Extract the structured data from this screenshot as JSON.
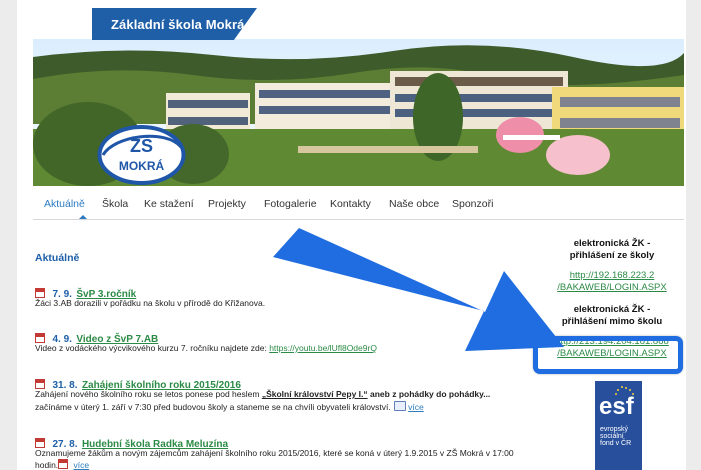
{
  "site": {
    "title": "Základní škola Mokrá",
    "logo_text": "ZŠ MOKRÁ"
  },
  "nav": {
    "items": [
      {
        "label": "Aktuálně",
        "active": true
      },
      {
        "label": "Škola"
      },
      {
        "label": "Ke stažení"
      },
      {
        "label": "Projekty"
      },
      {
        "label": "Fotogalerie"
      },
      {
        "label": "Kontakty"
      },
      {
        "label": "Naše obce"
      },
      {
        "label": "Sponzoři"
      }
    ]
  },
  "main": {
    "section_title": "Aktuálně",
    "news": [
      {
        "date": "7. 9.",
        "title": "ŠvP 3.ročník",
        "text": "Žáci 3.AB dorazili v pořádku na školu v přírodě do Křižanova."
      },
      {
        "date": "4. 9.",
        "title": "Video z ŠvP 7.AB",
        "text": "Video z vodáckého výcvikového kurzu 7. ročníku najdete zde: ",
        "link": "https://youtu.be/lUfl8Ode9rQ"
      },
      {
        "date": "31. 8.",
        "title": "Zahájení školního roku 2015/2016",
        "text_pre": "Zahájení nového školního roku se letos ponese pod heslem ",
        "text_highlight": "„Školní království Pepy I.“",
        "text_post": " aneb z pohádky do pohádky...",
        "text_line2": "začínáme v úterý 1. září v 7:30 před budovou školy a staneme se na chvíli obyvateli království.",
        "more": "více"
      },
      {
        "date": "27. 8.",
        "title": "Hudební škola Radka Meluzína",
        "text": "Oznamujeme žákům a novým zájemcům zahájení školního roku 2015/2016, které se koná v úterý 1.9.2015 v ZŠ Mokrá v 17:00",
        "text_line2": "hodin.",
        "more": "více"
      }
    ]
  },
  "sidebar": {
    "block1": {
      "title_line1": "elektronická ŽK -",
      "title_line2": "přihlášení ze školy",
      "link_line1": "http://192.168.223.2",
      "link_line2": "/BAKAWEB/LOGIN.ASPX"
    },
    "block2": {
      "title_line1": "elektronická ŽK -",
      "title_line2": "přihlášení mimo školu",
      "link_line1": "http://213.194.204.181:888",
      "link_line2": "/BAKAWEB/LOGIN.ASPX"
    },
    "esf": {
      "brand": "esf",
      "caption": "evropský\nsociální\nfond v ČR"
    }
  },
  "colors": {
    "accent": "#1f5fa8",
    "link_green": "#2b8a45",
    "annotation_arrow": "#1f6de0"
  }
}
